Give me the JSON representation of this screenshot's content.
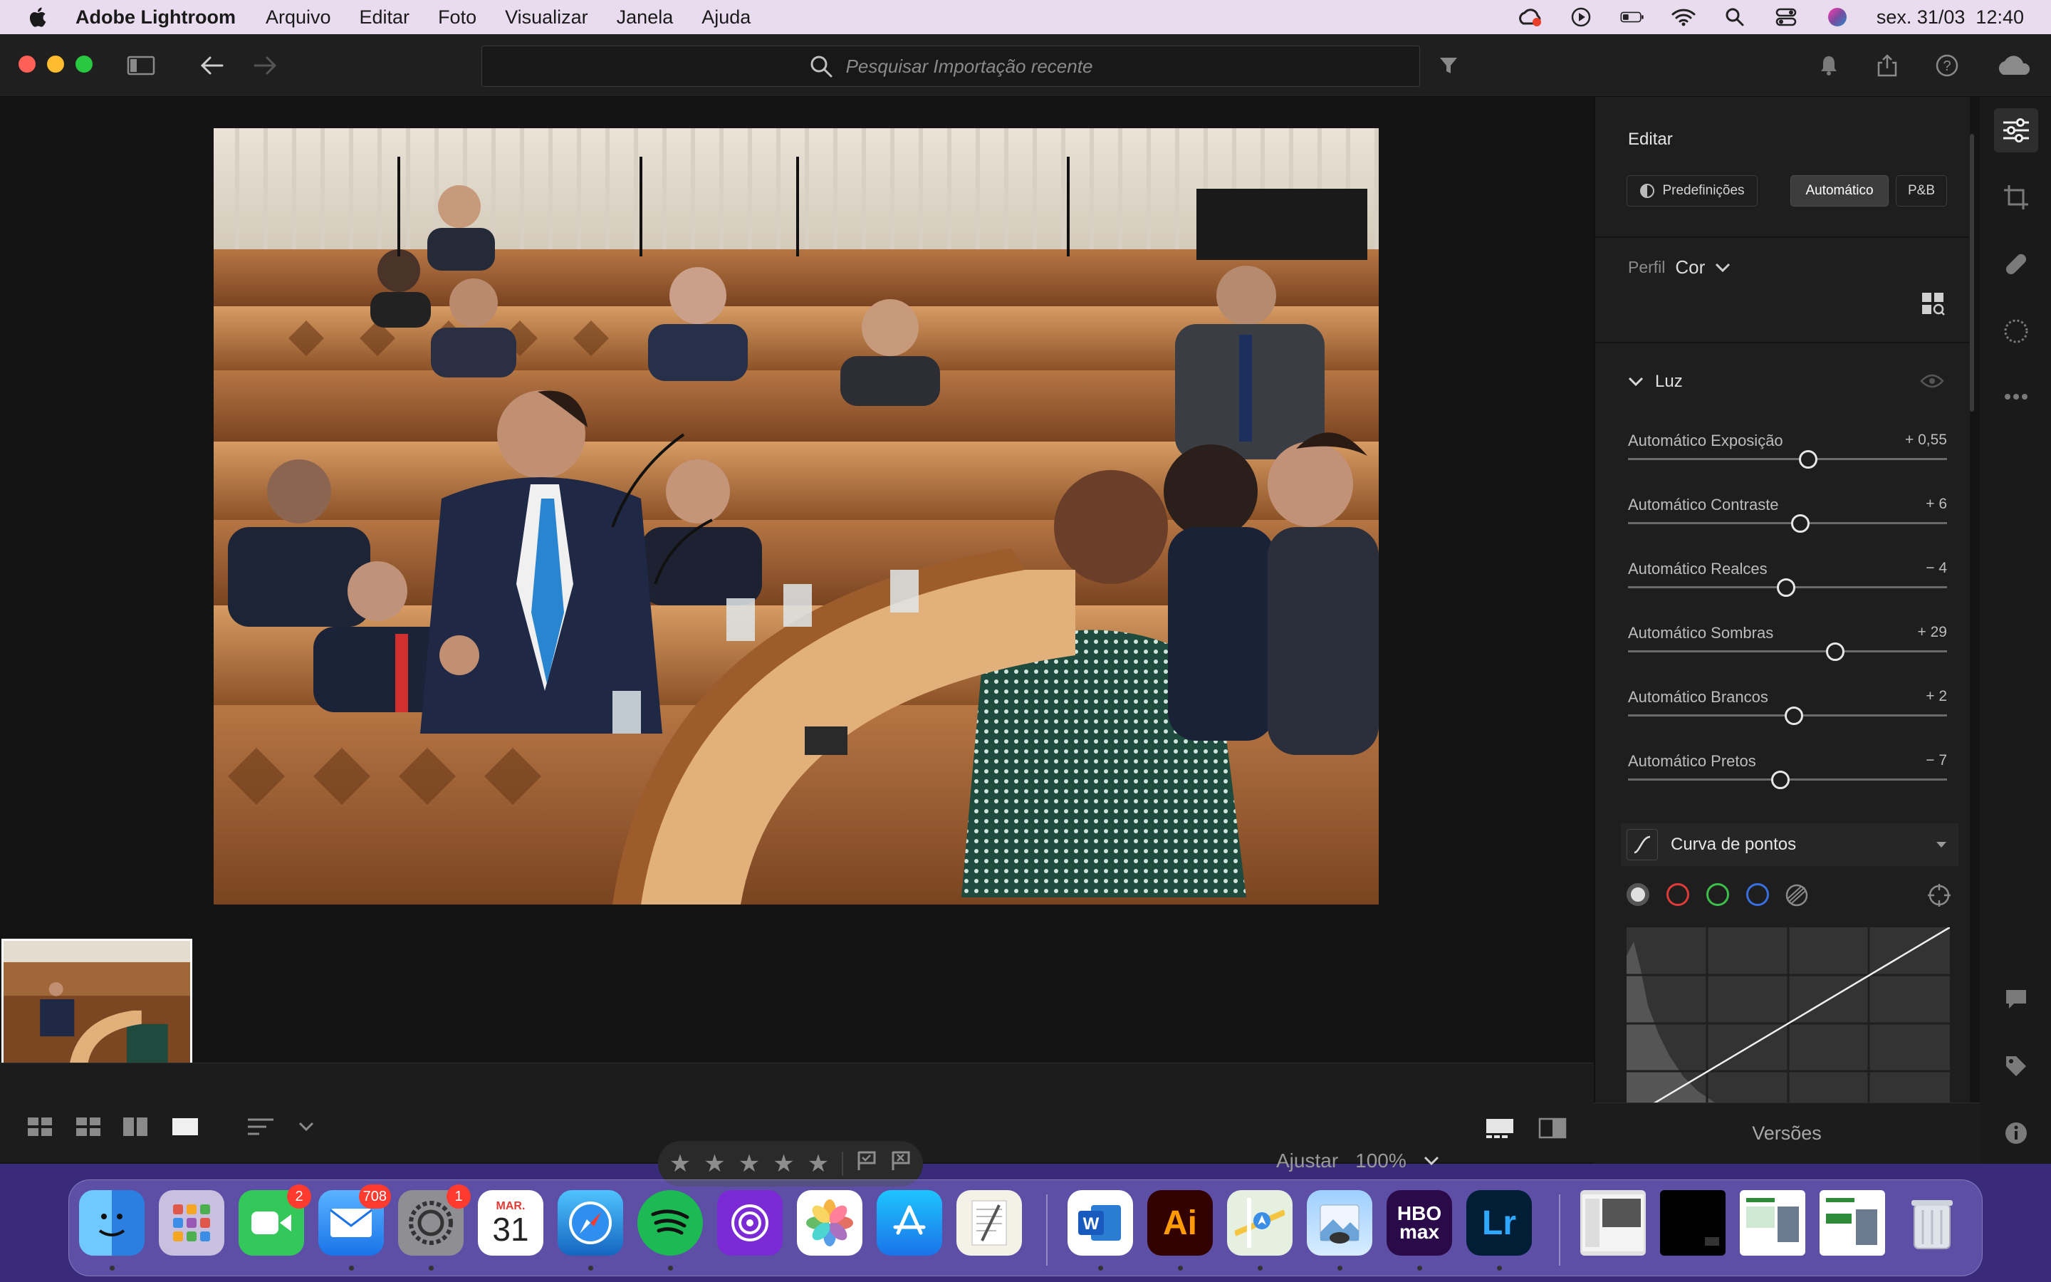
{
  "menubar": {
    "app_name": "Adobe Lightroom",
    "menus": [
      "Arquivo",
      "Editar",
      "Foto",
      "Visualizar",
      "Janela",
      "Ajuda"
    ],
    "clock": "sex. 31/03  12:40"
  },
  "search": {
    "placeholder": "Pesquisar Importação recente"
  },
  "edit_panel": {
    "title": "Editar",
    "buttons": {
      "presets": "Predefinições",
      "auto": "Automático",
      "bw": "P&B"
    },
    "profile_label": "Perfil",
    "profile_value": "Cor",
    "section_light": "Luz",
    "sliders": [
      {
        "label": "Automático Exposição",
        "value": "+ 0,55",
        "position": 0.565
      },
      {
        "label": "Automático Contraste",
        "value": "+ 6",
        "position": 0.54
      },
      {
        "label": "Automático Realces",
        "value": "− 4",
        "position": 0.495
      },
      {
        "label": "Automático Sombras",
        "value": "+ 29",
        "position": 0.65
      },
      {
        "label": "Automático Brancos",
        "value": "+ 2",
        "position": 0.52
      },
      {
        "label": "Automático Pretos",
        "value": "− 7",
        "position": 0.478
      }
    ],
    "curve_title": "Curva de pontos",
    "versions": "Versões"
  },
  "bottom_bar": {
    "zoom_label": "Ajustar",
    "zoom_value": "100%"
  },
  "dock": {
    "badges": {
      "facetime": "2",
      "mail": "708",
      "settings": "1"
    },
    "calendar_month": "MAR.",
    "calendar_day": "31",
    "illustrator": "Ai",
    "hbo": "HBO max",
    "lightroom": "Lr"
  },
  "colors": {
    "accent_panel": "#1e1e1e",
    "window_bg": "#141414",
    "menubar_bg": "#e9dcef",
    "dock_bg": "#786ec8"
  }
}
